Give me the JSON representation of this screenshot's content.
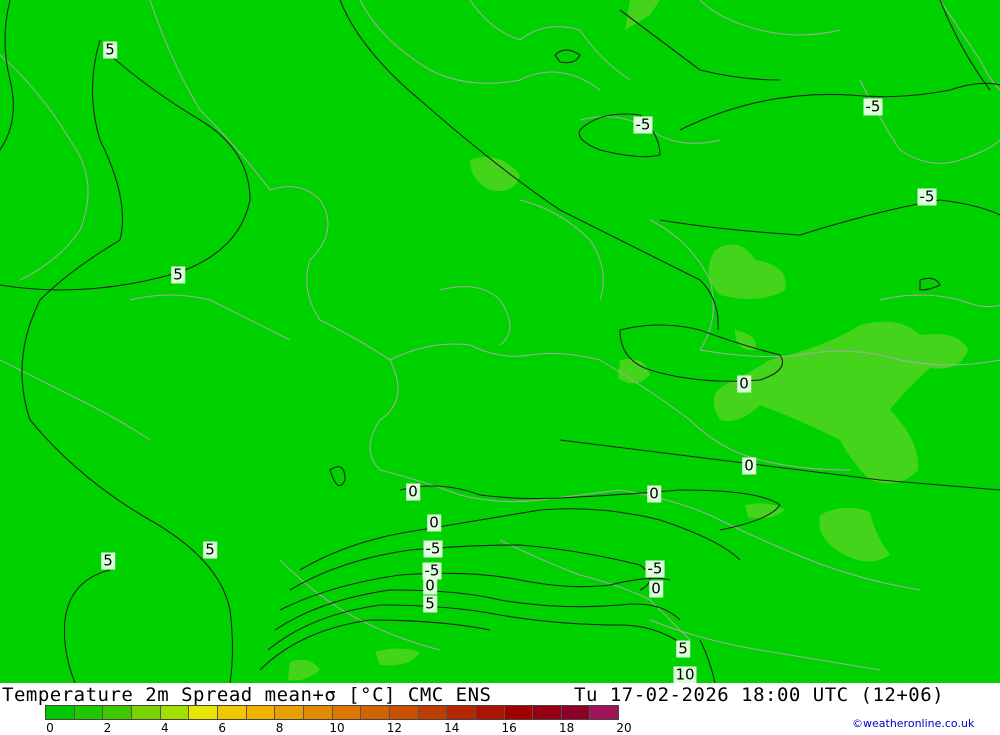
{
  "title": "Temperature 2m Spread mean+σ [°C] CMC ENS",
  "valid_time": "Tu 17-02-2026 18:00 UTC (12+06)",
  "credit": "©weatheronline.co.uk",
  "colors": {
    "background": "#00d200",
    "patch_light": "#44d41c",
    "contour": "#202020",
    "border": "#a8a8a8"
  },
  "legend": {
    "colors": [
      "#00c800",
      "#20c800",
      "#40c800",
      "#7ad200",
      "#a0e000",
      "#e6e600",
      "#f0c800",
      "#f0b400",
      "#e6a000",
      "#e08c00",
      "#dc7800",
      "#d26400",
      "#c85000",
      "#be3c00",
      "#b42800",
      "#aa1400",
      "#a00000",
      "#960014",
      "#8c0028",
      "#a0145a"
    ],
    "ticks": [
      "0",
      "2",
      "4",
      "6",
      "8",
      "10",
      "12",
      "14",
      "16",
      "18",
      "20"
    ]
  },
  "contour_labels": [
    {
      "id": "c1",
      "text": "5"
    },
    {
      "id": "c2",
      "text": "5"
    },
    {
      "id": "c3",
      "text": "-5"
    },
    {
      "id": "c4",
      "text": "-5"
    },
    {
      "id": "c5",
      "text": "-5"
    },
    {
      "id": "c6",
      "text": "0"
    },
    {
      "id": "c7",
      "text": "0"
    },
    {
      "id": "c8",
      "text": "0"
    },
    {
      "id": "c9",
      "text": "0"
    },
    {
      "id": "c10",
      "text": "0"
    },
    {
      "id": "c11",
      "text": "5"
    },
    {
      "id": "c12",
      "text": "5"
    },
    {
      "id": "c13",
      "text": "-5"
    },
    {
      "id": "c14",
      "text": "-5"
    },
    {
      "id": "c15",
      "text": "0"
    },
    {
      "id": "c16",
      "text": "5"
    },
    {
      "id": "c17",
      "text": "-5"
    },
    {
      "id": "c18",
      "text": "0"
    },
    {
      "id": "c19",
      "text": "5"
    },
    {
      "id": "c20",
      "text": "10"
    }
  ]
}
